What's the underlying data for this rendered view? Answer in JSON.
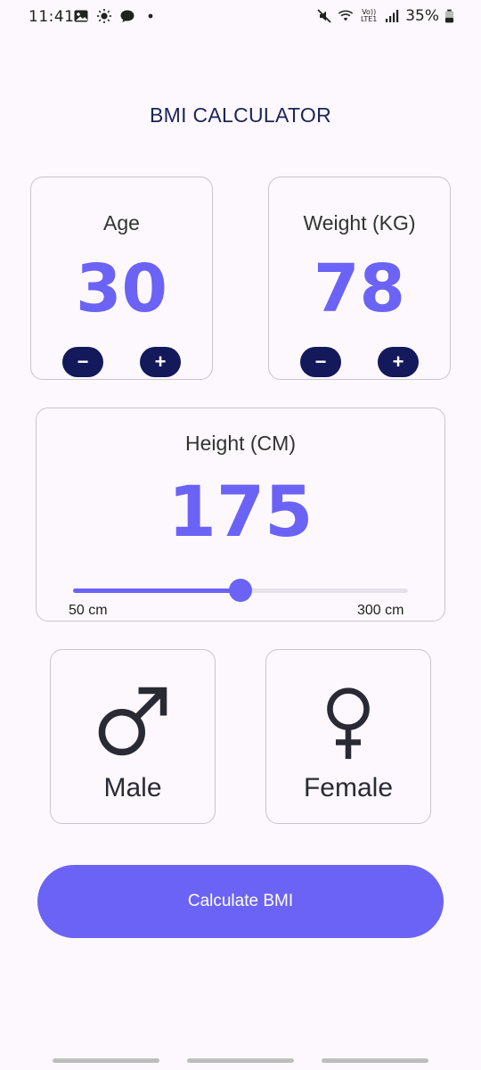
{
  "status_bar": {
    "time": "11:41",
    "battery": "35%",
    "left_icons": [
      "image-icon",
      "brightness-icon",
      "chat-icon",
      "dot-icon"
    ],
    "right_icons": [
      "mute-icon",
      "wifi-icon",
      "volte-icon",
      "signal-icon",
      "battery-icon"
    ],
    "volte_label": "Vo)) LTE1"
  },
  "app": {
    "title": "BMI CALCULATOR"
  },
  "age": {
    "label": "Age",
    "value": "30",
    "minus_label": "−",
    "plus_label": "+"
  },
  "weight": {
    "label": "Weight (KG)",
    "value": "78",
    "minus_label": "−",
    "plus_label": "+"
  },
  "height": {
    "label": "Height (CM)",
    "value": "175",
    "min_label": "50 cm",
    "max_label": "300 cm",
    "slider_fraction": 0.5
  },
  "gender": {
    "male_label": "Male",
    "female_label": "Female",
    "male_icon": "male-symbol-icon",
    "female_icon": "female-symbol-icon"
  },
  "action": {
    "calculate_label": "Calculate BMI"
  },
  "colors": {
    "accent": "#6b63f6",
    "dark_button": "#13195a",
    "title": "#1b2559",
    "background": "#fdf8fd"
  }
}
